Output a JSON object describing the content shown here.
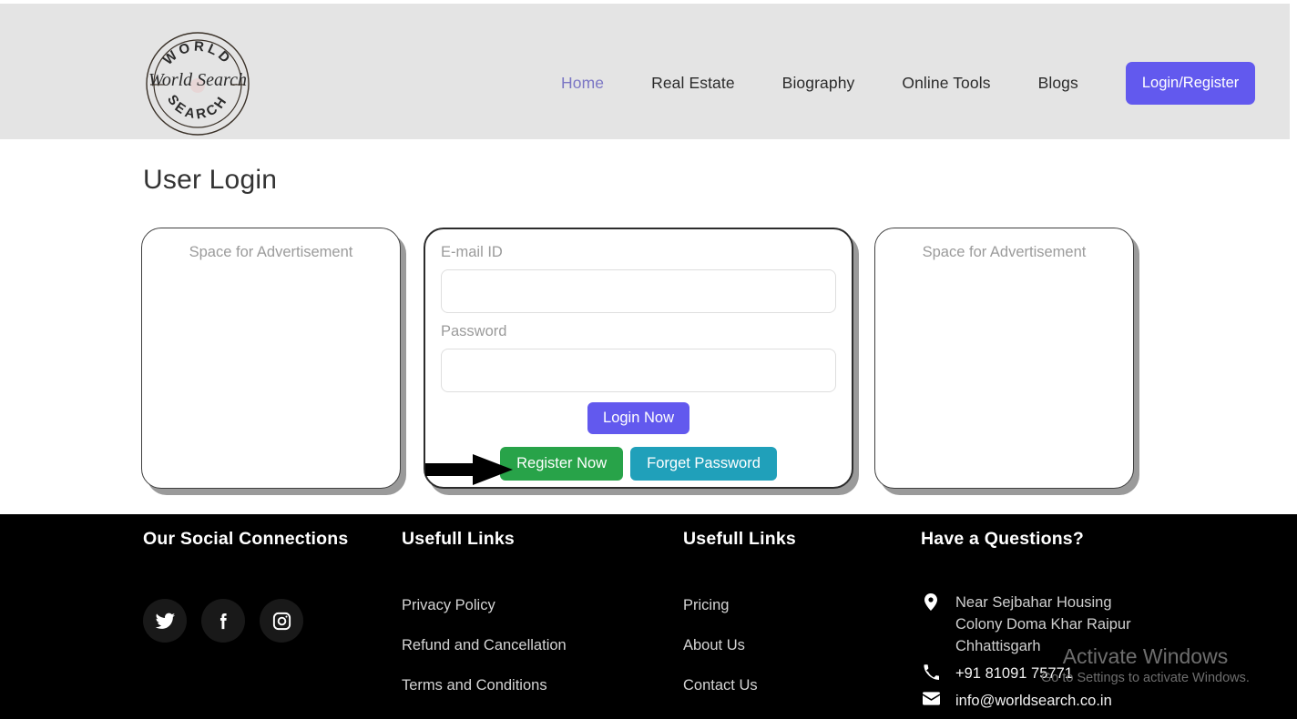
{
  "header": {
    "logo": {
      "top_text": "WORLD",
      "script_text": "World Search",
      "bottom_text": "SEARCH"
    },
    "nav": [
      {
        "label": "Home",
        "active": true
      },
      {
        "label": "Real Estate",
        "active": false
      },
      {
        "label": "Biography",
        "active": false
      },
      {
        "label": "Online Tools",
        "active": false
      },
      {
        "label": "Blogs",
        "active": false
      }
    ],
    "cta_label": "Login/Register"
  },
  "main": {
    "page_title": "User Login",
    "ad_left_text": "Space for Advertisement",
    "ad_right_text": "Space for Advertisement",
    "login_form": {
      "email_label": "E-mail ID",
      "email_value": "",
      "password_label": "Password",
      "password_value": "",
      "login_button": "Login Now",
      "register_button": "Register Now",
      "forget_button": "Forget Password"
    }
  },
  "footer": {
    "social_heading": "Our Social Connections",
    "social_icons": [
      "twitter-icon",
      "facebook-icon",
      "instagram-icon"
    ],
    "links_column_1": {
      "heading": "Usefull Links",
      "items": [
        "Privacy Policy",
        "Refund and Cancellation",
        "Terms and Conditions"
      ]
    },
    "links_column_2": {
      "heading": "Usefull Links",
      "items": [
        "Pricing",
        "About Us",
        "Contact Us"
      ]
    },
    "contact": {
      "heading": "Have a Questions?",
      "address_line_1": "Near Sejbahar Housing",
      "address_line_2": "Colony Doma Khar Raipur",
      "address_line_3": "Chhattisgarh",
      "phone": "+91 81091 75771",
      "email": "info@worldsearch.co.in"
    }
  },
  "watermark": {
    "title": "Activate Windows",
    "subtitle": "Go to Settings to activate Windows."
  },
  "colors": {
    "header_bg": "#e4e4e4",
    "accent_purple": "#6259ee",
    "active_nav": "#7b76c4",
    "register_green": "#28a349",
    "forget_teal": "#20a0ba",
    "footer_bg": "#000000"
  }
}
